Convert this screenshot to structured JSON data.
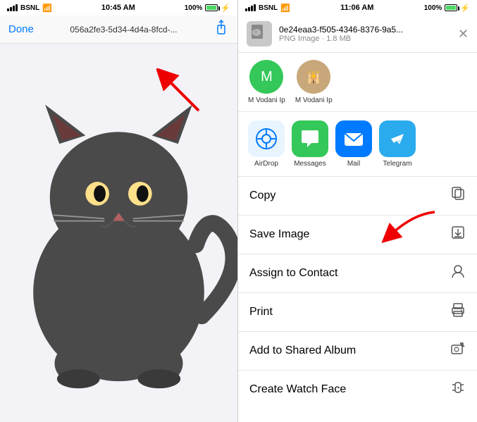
{
  "left": {
    "status": {
      "carrier": "BSNL",
      "time": "10:45 AM",
      "battery": "100%"
    },
    "nav": {
      "done_label": "Done",
      "title": "056a2fe3-5d34-4d4a-8fcd-..."
    }
  },
  "right": {
    "status": {
      "carrier": "BSNL",
      "time": "11:06 AM",
      "battery": "100%"
    },
    "file": {
      "name": "0e24eaa3-f505-4346-8376-9a5...",
      "meta": "PNG Image · 1.8 MB"
    },
    "contacts": [
      {
        "id": "m1",
        "initials": "M",
        "name": "M Vodani Ip",
        "type": "initial"
      },
      {
        "id": "m2",
        "initials": "",
        "name": "M Vodani Ip",
        "type": "image"
      }
    ],
    "apps": [
      {
        "id": "airdrop",
        "label": "AirDrop"
      },
      {
        "id": "messages",
        "label": "Messages"
      },
      {
        "id": "mail",
        "label": "Mail"
      },
      {
        "id": "telegram",
        "label": "Telegram"
      }
    ],
    "actions": [
      {
        "id": "copy",
        "label": "Copy",
        "icon": "⧉"
      },
      {
        "id": "save-image",
        "label": "Save Image",
        "icon": "⬇"
      },
      {
        "id": "assign-contact",
        "label": "Assign to Contact",
        "icon": "👤"
      },
      {
        "id": "print",
        "label": "Print",
        "icon": "🖨"
      },
      {
        "id": "shared-album",
        "label": "Add to Shared Album",
        "icon": "📷"
      },
      {
        "id": "watch-face",
        "label": "Create Watch Face",
        "icon": "⌚"
      }
    ]
  }
}
